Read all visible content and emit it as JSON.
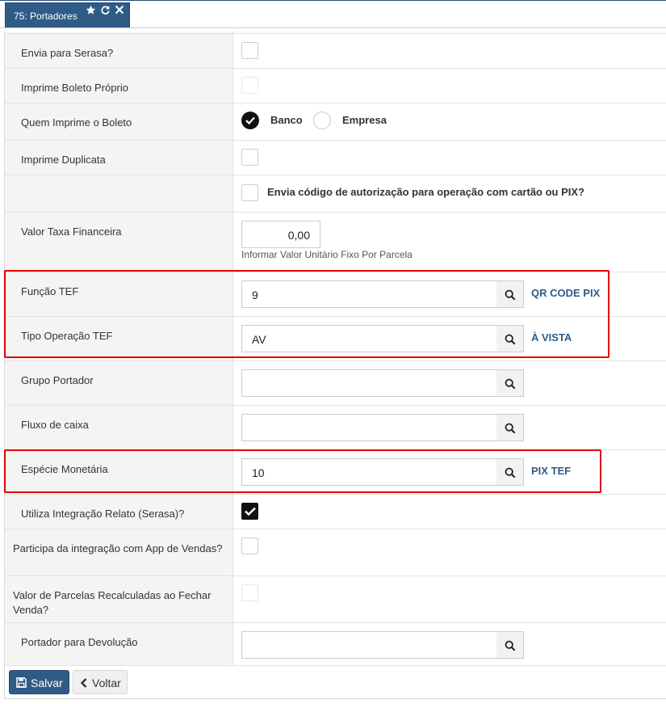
{
  "tab": {
    "title": "75: Portadores"
  },
  "fields": {
    "envia_serasa": {
      "label": "Envia para Serasa?"
    },
    "imprime_boleto": {
      "label": "Imprime Boleto Próprio"
    },
    "quem_imprime": {
      "label": "Quem Imprime o Boleto",
      "option_banco": "Banco",
      "option_empresa": "Empresa",
      "selected": "Banco"
    },
    "imprime_duplicata": {
      "label": "Imprime Duplicata"
    },
    "envia_codigo": {
      "label": "Envia código de autorização para operação com cartão ou PIX?"
    },
    "valor_taxa": {
      "label": "Valor Taxa Financeira",
      "value": "0,00",
      "hint": "Informar Valor Unitário Fixo Por Parcela"
    },
    "funcao_tef": {
      "label": "Função TEF",
      "value": "9",
      "description": "QR CODE PIX"
    },
    "tipo_operacao_tef": {
      "label": "Tipo Operação TEF",
      "value": "AV",
      "description": "À VISTA"
    },
    "grupo_portador": {
      "label": "Grupo Portador",
      "value": ""
    },
    "fluxo_caixa": {
      "label": "Fluxo de caixa",
      "value": ""
    },
    "especie_monetaria": {
      "label": "Espécie Monetária",
      "value": "10",
      "description": "PIX TEF"
    },
    "integracao_relato": {
      "label": "Utiliza Integração Relato (Serasa)?",
      "checked": true
    },
    "app_vendas": {
      "label": "Participa da integração com App de Vendas?"
    },
    "parcelas_recalculadas": {
      "label": "Valor de Parcelas Recalculadas ao Fechar Venda?"
    },
    "portador_devolucao": {
      "label": "Portador para Devolução",
      "value": ""
    }
  },
  "buttons": {
    "save": "Salvar",
    "back": "Voltar"
  },
  "colors": {
    "primary": "#2f5b87",
    "highlight": "#e00000"
  }
}
